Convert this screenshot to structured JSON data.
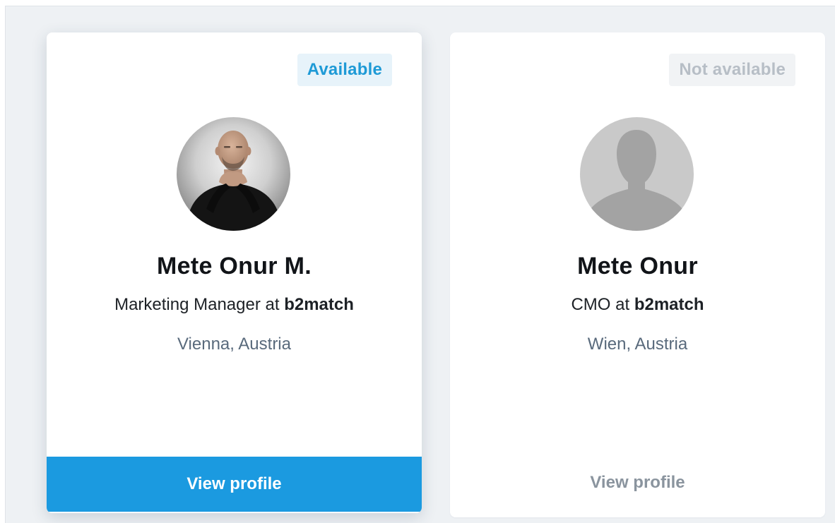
{
  "cards": [
    {
      "status": "Available",
      "name": "Mete Onur M.",
      "role_prefix": "Marketing Manager at ",
      "company": "b2match",
      "location": "Vienna, Austria",
      "button_label": "View profile",
      "avatar": "person-photo"
    },
    {
      "status": "Not available",
      "name": "Mete Onur",
      "role_prefix": "CMO at ",
      "company": "b2match",
      "location": "Wien, Austria",
      "button_label": "View profile",
      "avatar": "default-user-silhouette-icon"
    }
  ],
  "colors": {
    "accent": "#1b9ae0",
    "available_text": "#1e9ad6",
    "available_bg": "#e7f3fa",
    "unavailable_text": "#b7bec6",
    "unavailable_bg": "#f1f3f5",
    "page_bg": "#eef1f4"
  }
}
